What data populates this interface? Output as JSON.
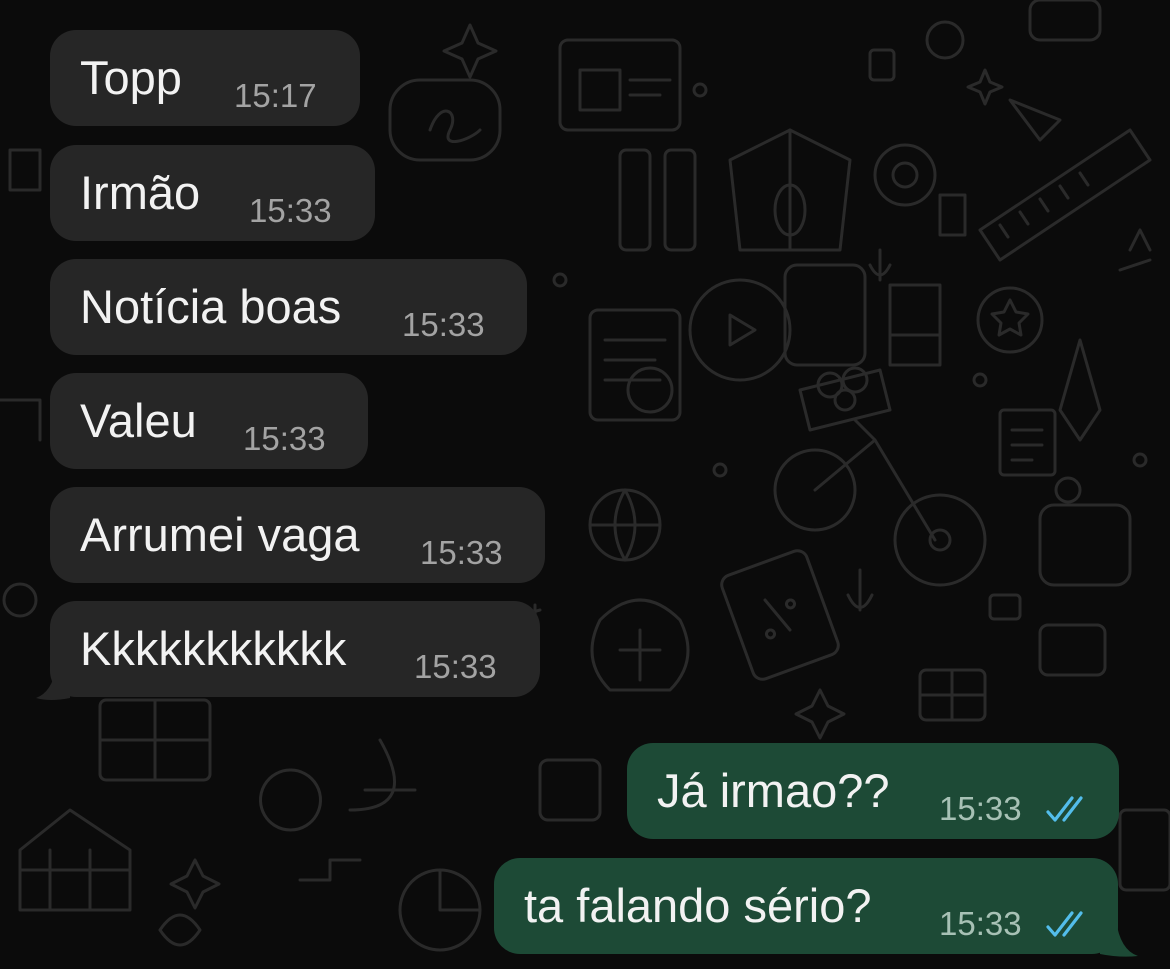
{
  "chat": {
    "incoming": [
      {
        "text": "Topp",
        "time": "15:17"
      },
      {
        "text": "Irmão",
        "time": "15:33"
      },
      {
        "text": "Notícia boas",
        "time": "15:33"
      },
      {
        "text": "Valeu",
        "time": "15:33"
      },
      {
        "text": "Arrumei vaga",
        "time": "15:33"
      },
      {
        "text": "Kkkkkkkkkkk",
        "time": "15:33"
      }
    ],
    "outgoing": [
      {
        "text": "Já irmao??",
        "time": "15:33",
        "status": "read"
      },
      {
        "text": "ta falando sério?",
        "time": "15:33",
        "status": "read"
      }
    ]
  },
  "colors": {
    "background": "#0b0b0b",
    "incoming_bubble": "#262626",
    "outgoing_bubble": "#1d4a36",
    "read_ticks": "#53bdeb"
  },
  "icons": {
    "read_receipt": "double-check-icon",
    "wallpaper": "doodle-pattern"
  }
}
